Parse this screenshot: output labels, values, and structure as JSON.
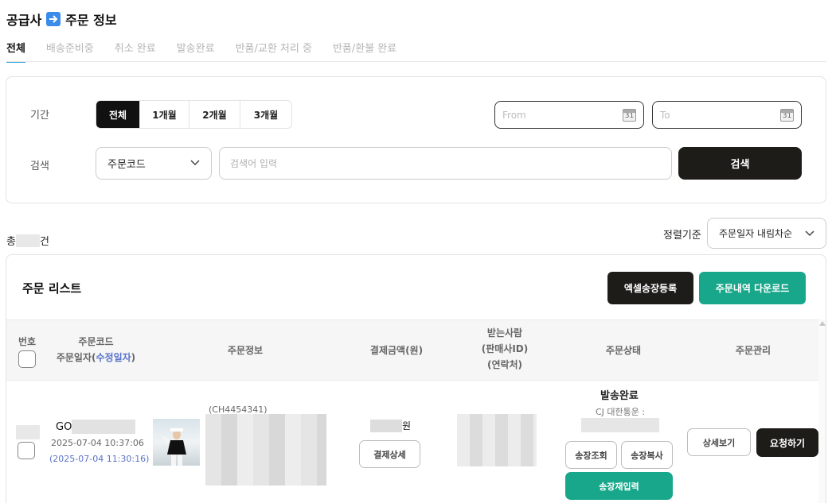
{
  "page": {
    "title_left": "공급사",
    "title_right": "주문 정보"
  },
  "tabs": [
    {
      "label": "전체",
      "active": true
    },
    {
      "label": "배송준비중",
      "active": false
    },
    {
      "label": "취소 완료",
      "active": false
    },
    {
      "label": "발송완료",
      "active": false
    },
    {
      "label": "반품/교환 처리 중",
      "active": false
    },
    {
      "label": "반품/환불 완료",
      "active": false
    }
  ],
  "filter": {
    "period_label": "기간",
    "period_options": [
      "전체",
      "1개월",
      "2개월",
      "3개월"
    ],
    "from_placeholder": "From",
    "to_placeholder": "To",
    "calendar_day": "31",
    "search_label": "검색",
    "search_type": "주문코드",
    "search_placeholder": "검색어 입력",
    "search_button": "검색"
  },
  "summary": {
    "total_prefix": "총",
    "total_suffix": "건",
    "sort_label": "정렬기준",
    "sort_value": "주문일자 내림차순"
  },
  "list": {
    "title": "주문 리스트",
    "excel_button": "엑셀송장등록",
    "download_button": "주문내역 다운로드",
    "headers": {
      "number": "번호",
      "code_line1": "주문코드",
      "code_line2": "주문일자(",
      "code_accent": "수정일자",
      "code_close": ")",
      "info": "주문정보",
      "amount": "결제금액(원)",
      "recipient_line1": "받는사람",
      "recipient_line2": "(판매사ID)",
      "recipient_line3": "(연락처)",
      "status": "주문상태",
      "manage": "주문관리"
    },
    "rows": [
      {
        "code_prefix": "GO",
        "order_date": "2025-07-04 10:37:06",
        "modified_date": "(2025-07-04 11:30:16)",
        "info_code": "(CH4454341)",
        "amount_suffix": "원",
        "payment_detail": "결제상세",
        "status": "발송완료",
        "carrier": "CJ 대한통운 :",
        "track_button": "송장조회",
        "copy_button": "송장복사",
        "reinput_button": "송장재입력",
        "detail_button": "상세보기",
        "request_button": "요청하기"
      }
    ]
  },
  "colors": {
    "dark": "#1e1c19",
    "teal": "#18a78a",
    "accent_blue": "#5a73c9",
    "tab_underline": "#3aa6d9"
  }
}
